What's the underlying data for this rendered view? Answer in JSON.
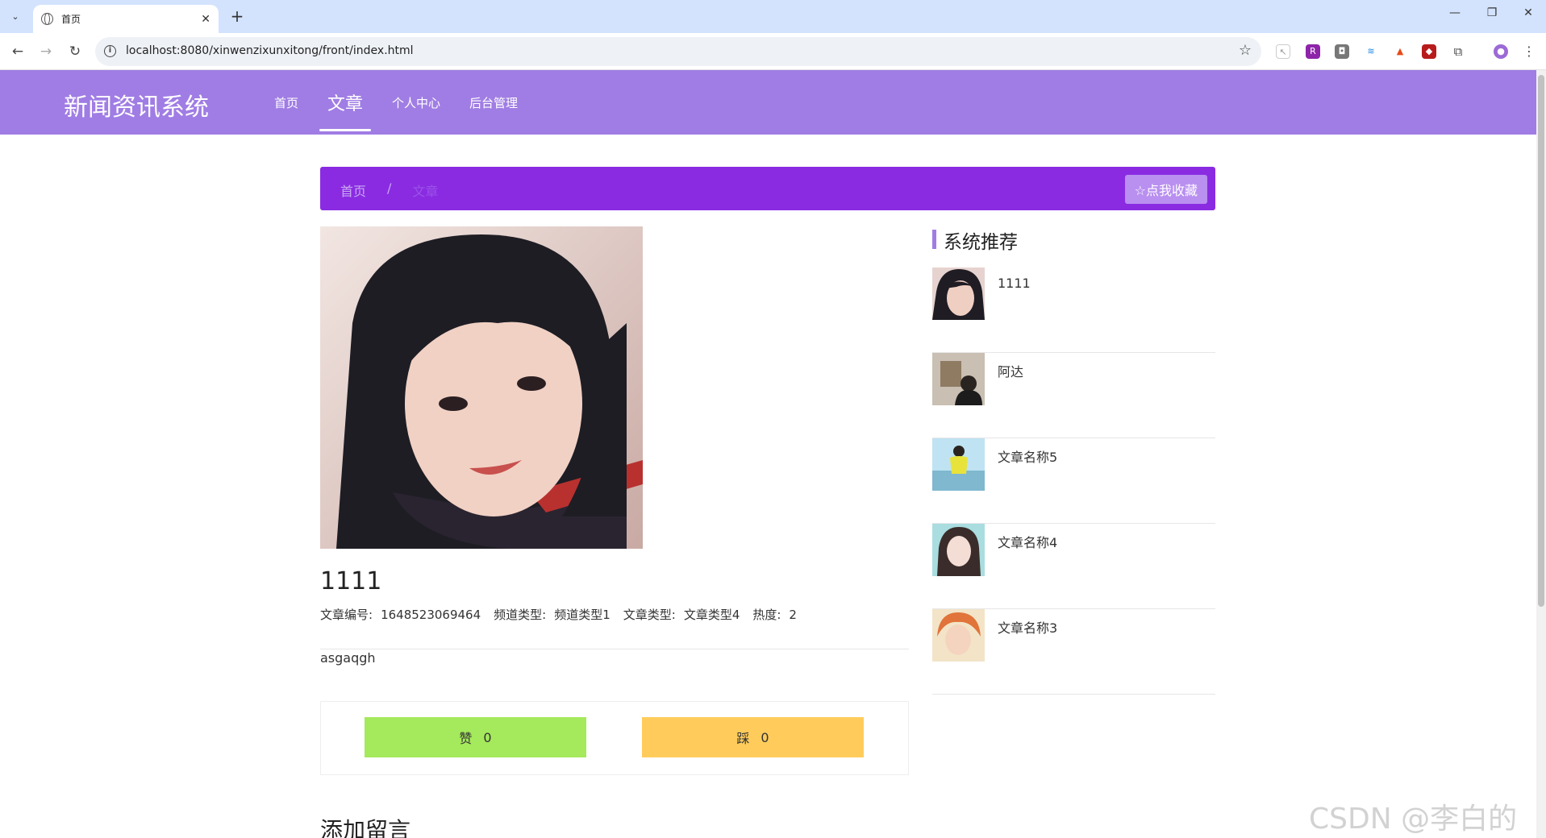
{
  "browser": {
    "tab_title": "首页",
    "url": "localhost:8080/xinwenzixunxitong/front/index.html"
  },
  "site": {
    "title": "新闻资讯系统",
    "nav": [
      "首页",
      "文章",
      "个人中心",
      "后台管理"
    ],
    "active_nav": "文章"
  },
  "breadcrumb": {
    "home": "首页",
    "separator": "/",
    "current": "文章",
    "favorite_button": "☆点我收藏"
  },
  "article": {
    "title": "1111",
    "meta": [
      {
        "label": "文章编号:",
        "value": "1648523069464"
      },
      {
        "label": "频道类型:",
        "value": "频道类型1"
      },
      {
        "label": "文章类型:",
        "value": "文章类型4"
      },
      {
        "label": "热度:",
        "value": "2"
      }
    ],
    "content": "asgaqgh",
    "like_label": "赞",
    "like_count": "0",
    "dislike_label": "踩",
    "dislike_count": "0"
  },
  "comments": {
    "heading": "添加留言"
  },
  "sidebar": {
    "title": "系统推荐",
    "items": [
      {
        "label": "1111"
      },
      {
        "label": "阿达"
      },
      {
        "label": "文章名称5"
      },
      {
        "label": "文章名称4"
      },
      {
        "label": "文章名称3"
      }
    ]
  },
  "watermark": "CSDN @李白的粉"
}
